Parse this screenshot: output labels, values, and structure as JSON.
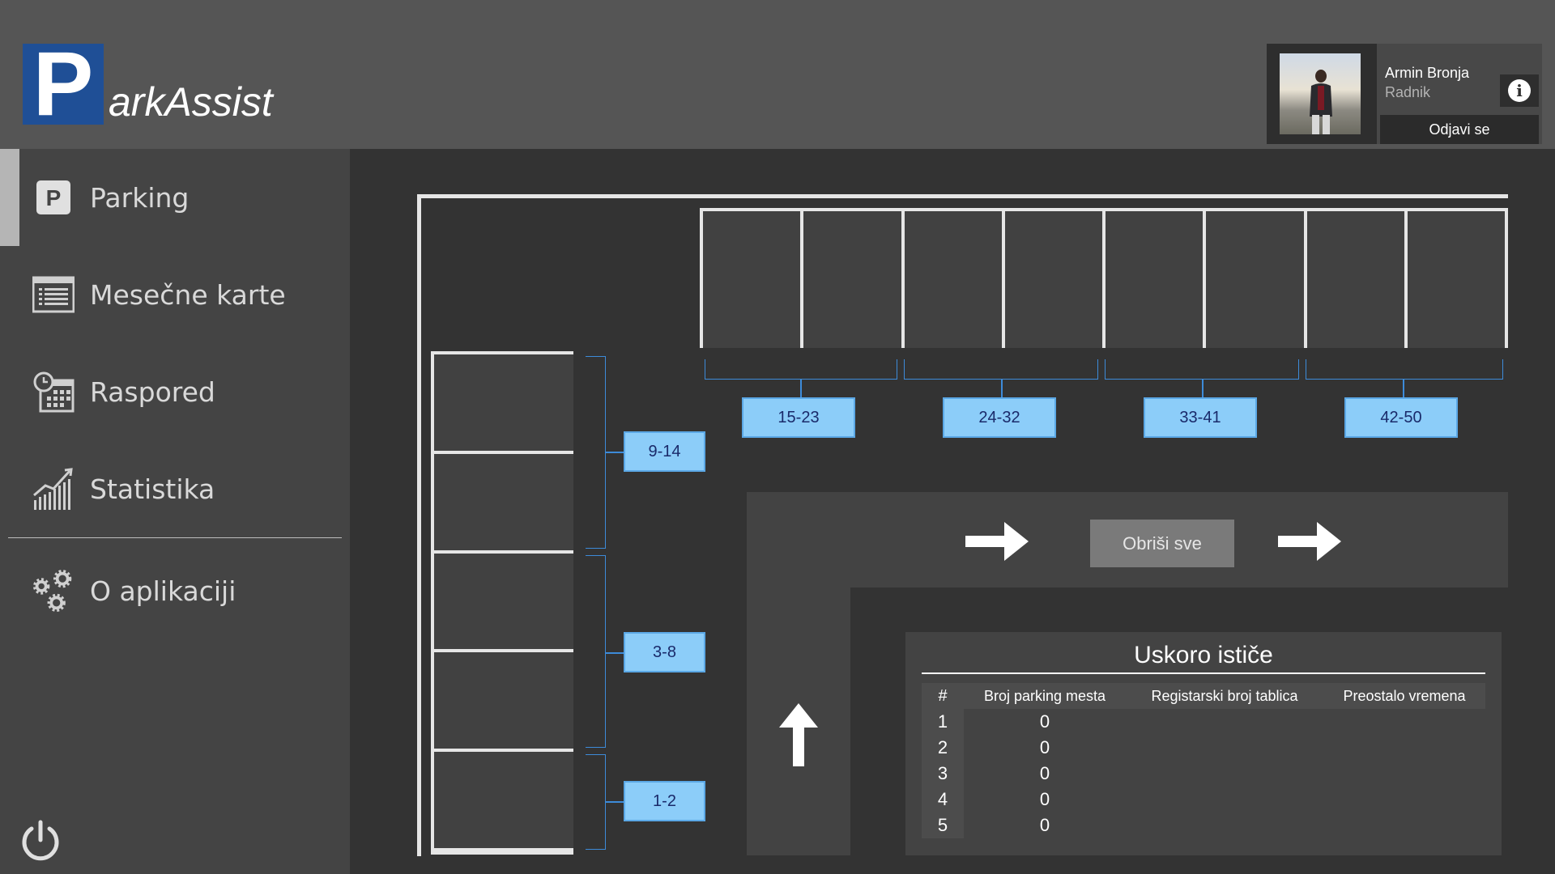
{
  "app": {
    "logo_letter": "P",
    "logo_text": "arkAssist",
    "brand_color": "#1f4f96"
  },
  "user": {
    "name": "Armin Bronja",
    "role": "Radnik",
    "logout_label": "Odjavi se",
    "info_icon": "i"
  },
  "sidebar": {
    "items": [
      {
        "label": "Parking",
        "icon": "parking-icon",
        "active": true
      },
      {
        "label": "Mesečne karte",
        "icon": "list-icon",
        "active": false
      },
      {
        "label": "Raspored",
        "icon": "calendar-clock-icon",
        "active": false
      },
      {
        "label": "Statistika",
        "icon": "chart-icon",
        "active": false
      },
      {
        "label": "O aplikaciji",
        "icon": "gears-icon",
        "active": false
      }
    ]
  },
  "parking_map": {
    "top_ranges": [
      "15-23",
      "24-32",
      "33-41",
      "42-50"
    ],
    "left_ranges": [
      "9-14",
      "3-8",
      "1-2"
    ],
    "label_color": "#8ccdf9",
    "clear_all_label": "Obriši sve"
  },
  "expiring": {
    "title": "Uskoro ističe",
    "columns": [
      "#",
      "Broj parking mesta",
      "Registarski broj tablica",
      "Preostalo vremena"
    ],
    "rows": [
      {
        "num": "1",
        "spot": "0",
        "plate": "",
        "remaining": ""
      },
      {
        "num": "2",
        "spot": "0",
        "plate": "",
        "remaining": ""
      },
      {
        "num": "3",
        "spot": "0",
        "plate": "",
        "remaining": ""
      },
      {
        "num": "4",
        "spot": "0",
        "plate": "",
        "remaining": ""
      },
      {
        "num": "5",
        "spot": "0",
        "plate": "",
        "remaining": ""
      }
    ]
  }
}
